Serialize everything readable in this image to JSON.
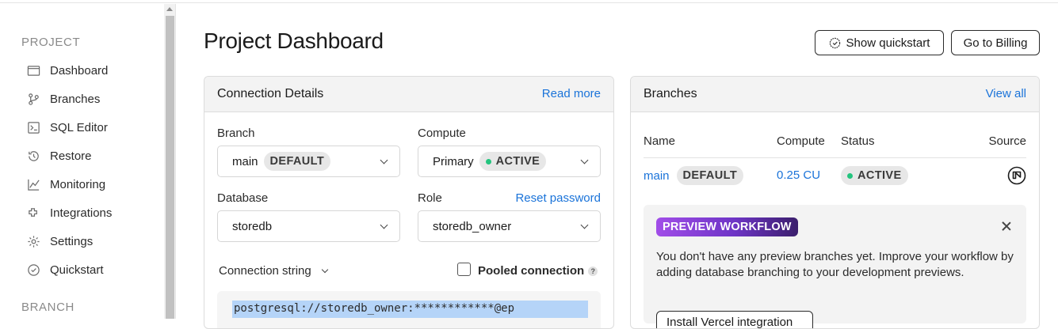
{
  "sidebar": {
    "project_heading": "PROJECT",
    "branch_heading": "BRANCH",
    "items": [
      {
        "label": "Dashboard",
        "icon": "dashboard-icon"
      },
      {
        "label": "Branches",
        "icon": "branches-icon"
      },
      {
        "label": "SQL Editor",
        "icon": "sql-editor-icon"
      },
      {
        "label": "Restore",
        "icon": "restore-icon"
      },
      {
        "label": "Monitoring",
        "icon": "monitoring-icon"
      },
      {
        "label": "Integrations",
        "icon": "integrations-icon"
      },
      {
        "label": "Settings",
        "icon": "gear-icon"
      },
      {
        "label": "Quickstart",
        "icon": "check-circle-icon"
      }
    ]
  },
  "header": {
    "title": "Project Dashboard",
    "quickstart_label": "Show quickstart",
    "billing_label": "Go to Billing"
  },
  "connection": {
    "title": "Connection Details",
    "read_more": "Read more",
    "branch_label": "Branch",
    "branch_value": "main",
    "branch_badge": "DEFAULT",
    "compute_label": "Compute",
    "compute_value": "Primary",
    "compute_badge": "ACTIVE",
    "database_label": "Database",
    "database_value": "storedb",
    "role_label": "Role",
    "reset_password": "Reset password",
    "role_value": "storedb_owner",
    "conn_string_label": "Connection string",
    "pooled_label": "Pooled connection",
    "pooled_help": "?",
    "conn_string": "postgresql://storedb_owner:************@ep"
  },
  "branches": {
    "title": "Branches",
    "view_all": "View all",
    "columns": [
      "Name",
      "Compute",
      "Status",
      "Source"
    ],
    "rows": [
      {
        "name": "main",
        "badge": "DEFAULT",
        "compute": "0.25 CU",
        "status": "ACTIVE"
      }
    ],
    "preview": {
      "badge": "PREVIEW WORKFLOW",
      "text": "You don't have any preview branches yet. Improve your workflow by adding database branching to your development previews.",
      "button": "Install Vercel integration"
    }
  },
  "colors": {
    "accent": "#1a73d9",
    "active_dot": "#23c47e",
    "badge_bg": "#e7e7e7"
  }
}
